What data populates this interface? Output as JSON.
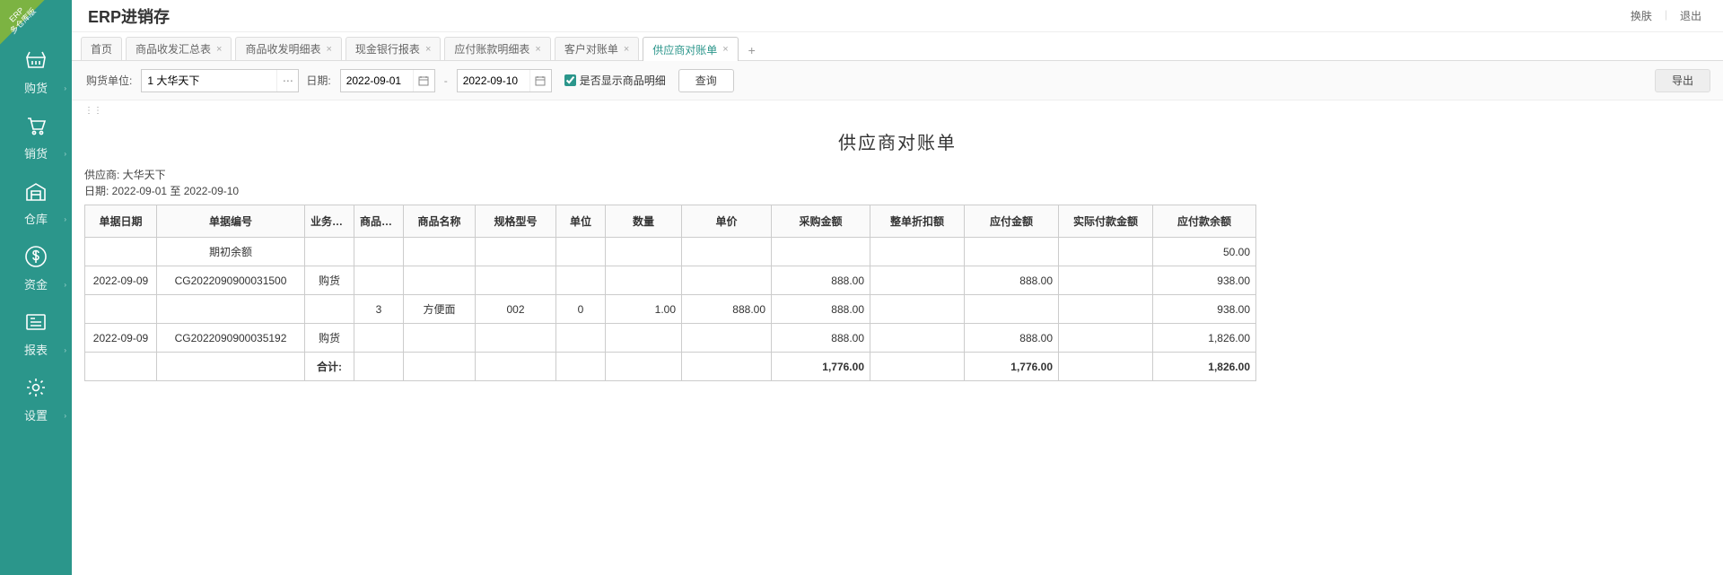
{
  "badge": {
    "line1": "ERP",
    "line2": "多仓库版"
  },
  "header": {
    "title": "ERP进销存",
    "skin": "换肤",
    "logout": "退出"
  },
  "sidebar": {
    "items": [
      {
        "label": "购货"
      },
      {
        "label": "销货"
      },
      {
        "label": "仓库"
      },
      {
        "label": "资金"
      },
      {
        "label": "报表"
      },
      {
        "label": "设置"
      }
    ]
  },
  "tabs": {
    "list": [
      {
        "label": "首页"
      },
      {
        "label": "商品收发汇总表"
      },
      {
        "label": "商品收发明细表"
      },
      {
        "label": "现金银行报表"
      },
      {
        "label": "应付账款明细表"
      },
      {
        "label": "客户对账单"
      },
      {
        "label": "供应商对账单"
      }
    ]
  },
  "filter": {
    "unit_label": "购货单位:",
    "unit_value": "1 大华天下",
    "date_label": "日期:",
    "date_from": "2022-09-01",
    "date_to": "2022-09-10",
    "show_detail_label": "是否显示商品明细",
    "query": "查询",
    "export": "导出"
  },
  "report": {
    "title": "供应商对账单",
    "supplier_label": "供应商: ",
    "supplier_value": "大华天下",
    "date_label": "日期: ",
    "date_range": "2022-09-01 至 2022-09-10",
    "columns": [
      "单据日期",
      "单据编号",
      "业务类别",
      "商品编号",
      "商品名称",
      "规格型号",
      "单位",
      "数量",
      "单价",
      "采购金额",
      "整单折扣额",
      "应付金额",
      "实际付款金额",
      "应付款余额"
    ],
    "rows": [
      {
        "date": "",
        "no": "期初余额",
        "type": "",
        "pid": "",
        "pname": "",
        "spec": "",
        "unit": "",
        "qty": "",
        "price": "",
        "amount": "",
        "discount": "",
        "payable": "",
        "paid": "",
        "balance": "50.00"
      },
      {
        "date": "2022-09-09",
        "no": "CG2022090900031500",
        "type": "购货",
        "pid": "",
        "pname": "",
        "spec": "",
        "unit": "",
        "qty": "",
        "price": "",
        "amount": "888.00",
        "discount": "",
        "payable": "888.00",
        "paid": "",
        "balance": "938.00"
      },
      {
        "date": "",
        "no": "",
        "type": "",
        "pid": "3",
        "pname": "方便面",
        "spec": "002",
        "unit": "0",
        "qty": "1.00",
        "price": "888.00",
        "amount": "888.00",
        "discount": "",
        "payable": "",
        "paid": "",
        "balance": "938.00"
      },
      {
        "date": "2022-09-09",
        "no": "CG2022090900035192",
        "type": "购货",
        "pid": "",
        "pname": "",
        "spec": "",
        "unit": "",
        "qty": "",
        "price": "",
        "amount": "888.00",
        "discount": "",
        "payable": "888.00",
        "paid": "",
        "balance": "1,826.00"
      }
    ],
    "total": {
      "label": "合计:",
      "amount": "1,776.00",
      "payable": "1,776.00",
      "balance": "1,826.00"
    }
  }
}
